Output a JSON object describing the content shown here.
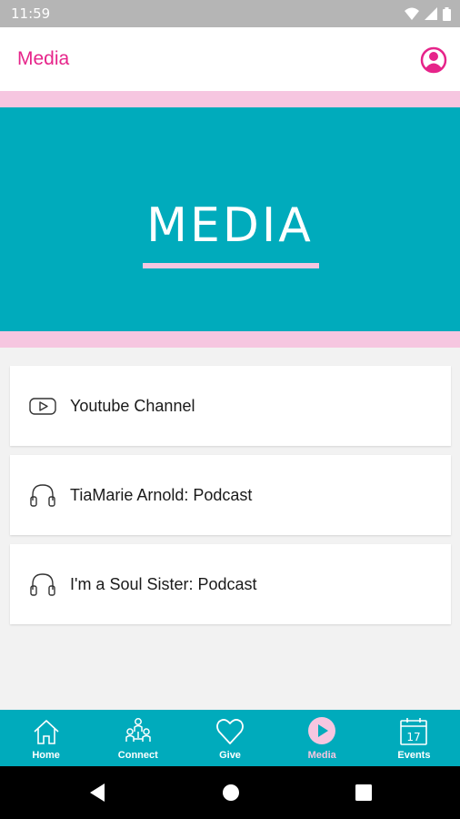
{
  "status_bar": {
    "time": "11:59",
    "icons": [
      "wifi-icon",
      "signal-icon",
      "battery-icon"
    ]
  },
  "app_bar": {
    "title": "Media",
    "profile_icon": "profile-icon"
  },
  "hero": {
    "title": "MEDIA"
  },
  "media_items": [
    {
      "label": "Youtube Channel",
      "icon": "youtube-icon"
    },
    {
      "label": "TiaMarie Arnold: Podcast",
      "icon": "headphones-icon"
    },
    {
      "label": "I'm a Soul Sister: Podcast",
      "icon": "headphones-icon"
    }
  ],
  "bottom_nav": [
    {
      "label": "Home",
      "icon": "home-icon"
    },
    {
      "label": "Connect",
      "icon": "connect-icon"
    },
    {
      "label": "Give",
      "icon": "heart-icon"
    },
    {
      "label": "Media",
      "icon": "play-icon",
      "active": true
    },
    {
      "label": "Events",
      "icon": "calendar-icon",
      "calendar_day": "17"
    }
  ],
  "colors": {
    "brand_pink": "#e6248a",
    "teal": "#00abbc",
    "light_pink": "#f6c6e0"
  }
}
